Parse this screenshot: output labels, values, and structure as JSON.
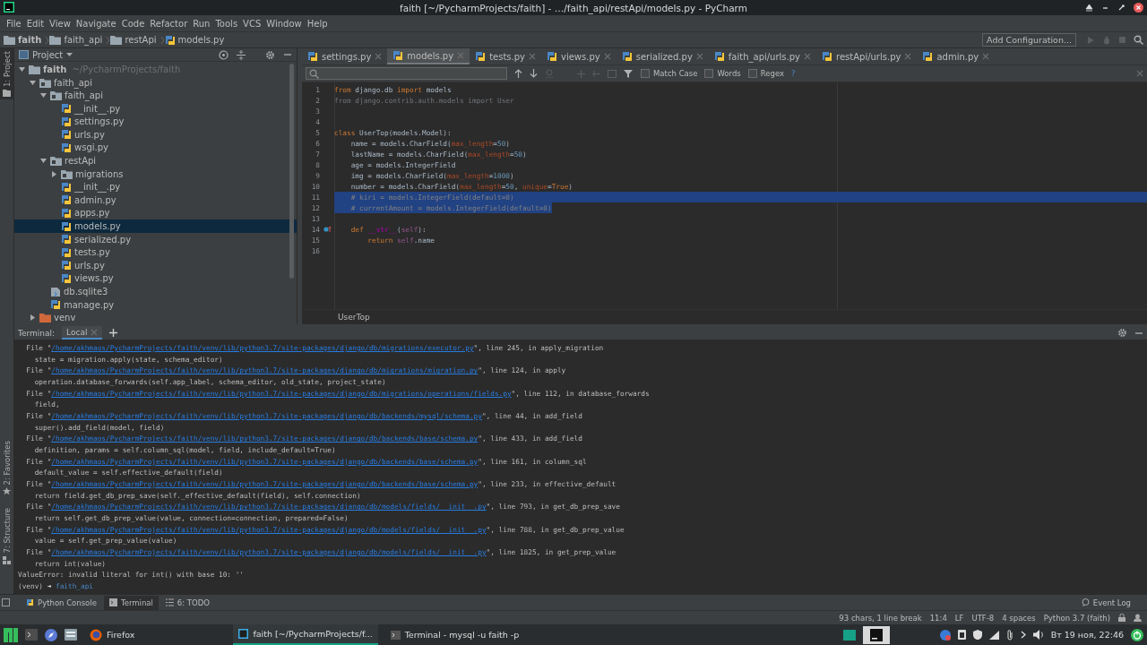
{
  "window": {
    "title": "faith [~/PycharmProjects/faith] - …/faith_api/restApi/models.py - PyCharm"
  },
  "menu": [
    "File",
    "Edit",
    "View",
    "Navigate",
    "Code",
    "Refactor",
    "Run",
    "Tools",
    "VCS",
    "Window",
    "Help"
  ],
  "breadcrumbs": [
    {
      "label": "faith",
      "kind": "root"
    },
    {
      "label": "faith_api",
      "kind": "module"
    },
    {
      "label": "restApi",
      "kind": "module"
    },
    {
      "label": "models.py",
      "kind": "python"
    }
  ],
  "run_config": {
    "label": "Add Configuration..."
  },
  "left_stripe": [
    {
      "label": "1: Project",
      "kind": "project",
      "selected": true
    },
    {
      "label": "2: Favorites",
      "kind": "favorites",
      "selected": false
    },
    {
      "label": "7: Structure",
      "kind": "structure",
      "selected": false
    }
  ],
  "project": {
    "title": "Project",
    "tree": [
      {
        "label": "faith",
        "hint": "~/PycharmProjects/faith",
        "kind": "root",
        "expanded": true,
        "selected": false,
        "children": [
          {
            "label": "faith_api",
            "kind": "module",
            "expanded": true,
            "selected": false,
            "children": [
              {
                "label": "faith_api",
                "kind": "module",
                "expanded": true,
                "selected": false,
                "children": [
                  {
                    "label": "__init__.py",
                    "kind": "python",
                    "selected": false
                  },
                  {
                    "label": "settings.py",
                    "kind": "python",
                    "selected": false
                  },
                  {
                    "label": "urls.py",
                    "kind": "python",
                    "selected": false
                  },
                  {
                    "label": "wsgi.py",
                    "kind": "python",
                    "selected": false
                  }
                ]
              },
              {
                "label": "restApi",
                "kind": "module",
                "expanded": true,
                "selected": false,
                "children": [
                  {
                    "label": "migrations",
                    "kind": "module",
                    "expanded": false,
                    "selected": false
                  },
                  {
                    "label": "__init__.py",
                    "kind": "python",
                    "selected": false
                  },
                  {
                    "label": "admin.py",
                    "kind": "python",
                    "selected": false
                  },
                  {
                    "label": "apps.py",
                    "kind": "python",
                    "selected": false
                  },
                  {
                    "label": "models.py",
                    "kind": "python",
                    "selected": true
                  },
                  {
                    "label": "serialized.py",
                    "kind": "python",
                    "selected": false
                  },
                  {
                    "label": "tests.py",
                    "kind": "python",
                    "selected": false
                  },
                  {
                    "label": "urls.py",
                    "kind": "python",
                    "selected": false
                  },
                  {
                    "label": "views.py",
                    "kind": "python",
                    "selected": false
                  }
                ]
              },
              {
                "label": "db.sqlite3",
                "kind": "db",
                "selected": false
              },
              {
                "label": "manage.py",
                "kind": "python",
                "selected": false
              }
            ]
          },
          {
            "label": "venv",
            "kind": "excluded",
            "expanded": false,
            "selected": false
          }
        ]
      }
    ]
  },
  "editor": {
    "tabs": [
      {
        "label": "settings.py",
        "selected": false
      },
      {
        "label": "models.py",
        "selected": true
      },
      {
        "label": "tests.py",
        "selected": false
      },
      {
        "label": "views.py",
        "selected": false
      },
      {
        "label": "serialized.py",
        "selected": false
      },
      {
        "label": "faith_api/urls.py",
        "selected": false
      },
      {
        "label": "restApi/urls.py",
        "selected": false
      },
      {
        "label": "admin.py",
        "selected": false
      }
    ],
    "search_options": [
      {
        "label": "Match Case",
        "checked": false
      },
      {
        "label": "Words",
        "checked": false
      },
      {
        "label": "Regex",
        "checked": false
      }
    ],
    "search_help": "?",
    "lines": [
      {
        "number": "1",
        "selected": false,
        "override": false,
        "tokens": [
          {
            "kind": "kw",
            "text": "from"
          },
          {
            "kind": "plain",
            "text": " django.db "
          },
          {
            "kind": "kw",
            "text": "import"
          },
          {
            "kind": "plain",
            "text": " models"
          }
        ]
      },
      {
        "number": "2",
        "selected": false,
        "override": false,
        "tokens": [
          {
            "kind": "unused",
            "text": "from django.contrib.auth.models import User"
          }
        ]
      },
      {
        "number": "3",
        "selected": false,
        "override": false
      },
      {
        "number": "4",
        "selected": false,
        "override": false
      },
      {
        "number": "5",
        "selected": false,
        "override": false,
        "tokens": [
          {
            "kind": "kw",
            "text": "class"
          },
          {
            "kind": "plain",
            "text": " UserTop(models.Model):"
          }
        ]
      },
      {
        "number": "6",
        "selected": false,
        "override": false,
        "tokens": [
          {
            "kind": "plain",
            "text": "    name = models.CharField("
          },
          {
            "kind": "param",
            "text": "max_length"
          },
          {
            "kind": "plain",
            "text": "="
          },
          {
            "kind": "num",
            "text": "50"
          },
          {
            "kind": "plain",
            "text": ")"
          }
        ]
      },
      {
        "number": "7",
        "selected": false,
        "override": false,
        "tokens": [
          {
            "kind": "plain",
            "text": "    lastName = models.CharField("
          },
          {
            "kind": "param",
            "text": "max_length"
          },
          {
            "kind": "plain",
            "text": "="
          },
          {
            "kind": "num",
            "text": "50"
          },
          {
            "kind": "plain",
            "text": ")"
          }
        ]
      },
      {
        "number": "8",
        "selected": false,
        "override": false,
        "tokens": [
          {
            "kind": "plain",
            "text": "    age = models.IntegerField"
          }
        ]
      },
      {
        "number": "9",
        "selected": false,
        "override": false,
        "tokens": [
          {
            "kind": "plain",
            "text": "    img = models.CharField("
          },
          {
            "kind": "param",
            "text": "max_length"
          },
          {
            "kind": "plain",
            "text": "="
          },
          {
            "kind": "num",
            "text": "1000"
          },
          {
            "kind": "plain",
            "text": ")"
          }
        ]
      },
      {
        "number": "10",
        "selected": false,
        "override": false,
        "tokens": [
          {
            "kind": "plain",
            "text": "    number = models.CharField("
          },
          {
            "kind": "param",
            "text": "max_length"
          },
          {
            "kind": "plain",
            "text": "="
          },
          {
            "kind": "num",
            "text": "50"
          },
          {
            "kind": "plain",
            "text": ", "
          },
          {
            "kind": "param",
            "text": "unique"
          },
          {
            "kind": "plain",
            "text": "="
          },
          {
            "kind": "kw",
            "text": "True"
          },
          {
            "kind": "plain",
            "text": ")"
          }
        ]
      },
      {
        "number": "11",
        "selected": true,
        "override": false,
        "tokens": [
          {
            "kind": "comment",
            "text": "    # kiri = models.IntegerField(default=0)"
          }
        ]
      },
      {
        "number": "12",
        "selected": true,
        "override": false,
        "tokens": [
          {
            "kind": "comment",
            "text": "    # currentAmount = models.IntegerField(default=0)"
          }
        ]
      },
      {
        "number": "13",
        "selected": false,
        "override": false
      },
      {
        "number": "14",
        "selected": false,
        "override": true,
        "tokens": [
          {
            "kind": "kw",
            "text": "    def"
          },
          {
            "kind": "magic",
            "text": " __str__"
          },
          {
            "kind": "plain",
            "text": "("
          },
          {
            "kind": "self",
            "text": "self"
          },
          {
            "kind": "plain",
            "text": "):"
          }
        ]
      },
      {
        "number": "15",
        "selected": false,
        "override": false,
        "tokens": [
          {
            "kind": "kw",
            "text": "        return"
          },
          {
            "kind": "self",
            "text": " self"
          },
          {
            "kind": "plain",
            "text": ".name"
          }
        ]
      },
      {
        "number": "16",
        "selected": false,
        "override": false
      }
    ],
    "breadcrumb": "UserTop"
  },
  "terminal": {
    "label": "Terminal:",
    "tabs": [
      {
        "label": "Local",
        "selected": true
      }
    ],
    "lines": [
      {
        "kind": "trace",
        "pre": "File \"",
        "link": "/home/akhmaos/PycharmProjects/faith/venv/lib/python3.7/site-packages/django/db/migrations/executor.py",
        "post": "\", line 245, in apply_migration"
      },
      {
        "kind": "text",
        "text": "  state = migration.apply(state, schema_editor)"
      },
      {
        "kind": "trace",
        "pre": "File \"",
        "link": "/home/akhmaos/PycharmProjects/faith/venv/lib/python3.7/site-packages/django/db/migrations/migration.py",
        "post": "\", line 124, in apply"
      },
      {
        "kind": "text",
        "text": "  operation.database_forwards(self.app_label, schema_editor, old_state, project_state)"
      },
      {
        "kind": "trace",
        "pre": "File \"",
        "link": "/home/akhmaos/PycharmProjects/faith/venv/lib/python3.7/site-packages/django/db/migrations/operations/fields.py",
        "post": "\", line 112, in database_forwards"
      },
      {
        "kind": "text",
        "text": "  field,"
      },
      {
        "kind": "trace",
        "pre": "File \"",
        "link": "/home/akhmaos/PycharmProjects/faith/venv/lib/python3.7/site-packages/django/db/backends/mysql/schema.py",
        "post": "\", line 44, in add_field"
      },
      {
        "kind": "text",
        "text": "  super().add_field(model, field)"
      },
      {
        "kind": "trace",
        "pre": "File \"",
        "link": "/home/akhmaos/PycharmProjects/faith/venv/lib/python3.7/site-packages/django/db/backends/base/schema.py",
        "post": "\", line 433, in add_field"
      },
      {
        "kind": "text",
        "text": "  definition, params = self.column_sql(model, field, include_default=True)"
      },
      {
        "kind": "trace",
        "pre": "File \"",
        "link": "/home/akhmaos/PycharmProjects/faith/venv/lib/python3.7/site-packages/django/db/backends/base/schema.py",
        "post": "\", line 161, in column_sql"
      },
      {
        "kind": "text",
        "text": "  default_value = self.effective_default(field)"
      },
      {
        "kind": "trace",
        "pre": "File \"",
        "link": "/home/akhmaos/PycharmProjects/faith/venv/lib/python3.7/site-packages/django/db/backends/base/schema.py",
        "post": "\", line 233, in effective_default"
      },
      {
        "kind": "text",
        "text": "  return field.get_db_prep_save(self._effective_default(field), self.connection)"
      },
      {
        "kind": "trace",
        "pre": "File \"",
        "link": "/home/akhmaos/PycharmProjects/faith/venv/lib/python3.7/site-packages/django/db/models/fields/__init__.py",
        "post": "\", line 793, in get_db_prep_save"
      },
      {
        "kind": "text",
        "text": "  return self.get_db_prep_value(value, connection=connection, prepared=False)"
      },
      {
        "kind": "trace",
        "pre": "File \"",
        "link": "/home/akhmaos/PycharmProjects/faith/venv/lib/python3.7/site-packages/django/db/models/fields/__init__.py",
        "post": "\", line 788, in get_db_prep_value"
      },
      {
        "kind": "text",
        "text": "  value = self.get_prep_value(value)"
      },
      {
        "kind": "trace",
        "pre": "File \"",
        "link": "/home/akhmaos/PycharmProjects/faith/venv/lib/python3.7/site-packages/django/db/models/fields/__init__.py",
        "post": "\", line 1825, in get_prep_value"
      },
      {
        "kind": "text",
        "text": "  return int(value)"
      },
      {
        "kind": "error",
        "text": "ValueError: invalid literal for int() with base 10: ''"
      },
      {
        "kind": "prompt",
        "venv": "(venv)",
        "arrow": "➜",
        "dir": "faith_api"
      }
    ]
  },
  "tool_windows": [
    {
      "label": "Python Console",
      "kind": "console",
      "selected": false
    },
    {
      "label": "Terminal",
      "kind": "terminal",
      "selected": true
    },
    {
      "label": "6: TODO",
      "kind": "todo",
      "selected": false
    }
  ],
  "event_log": "Event Log",
  "status_bar": [
    "93 chars, 1 line break",
    "11:4",
    "LF",
    "UTF-8",
    "4 spaces",
    "Python 3.7 (faith)"
  ],
  "taskbar": {
    "launchers": [
      {
        "label": "Firefox"
      }
    ],
    "tasks": [
      {
        "label": "faith [~/PycharmProjects/f...",
        "kind": "ide",
        "selected": true
      },
      {
        "label": "Terminal - mysql -u faith -p",
        "kind": "terminal",
        "selected": false
      }
    ],
    "clock": "Вт 19 ноя, 22:46"
  }
}
